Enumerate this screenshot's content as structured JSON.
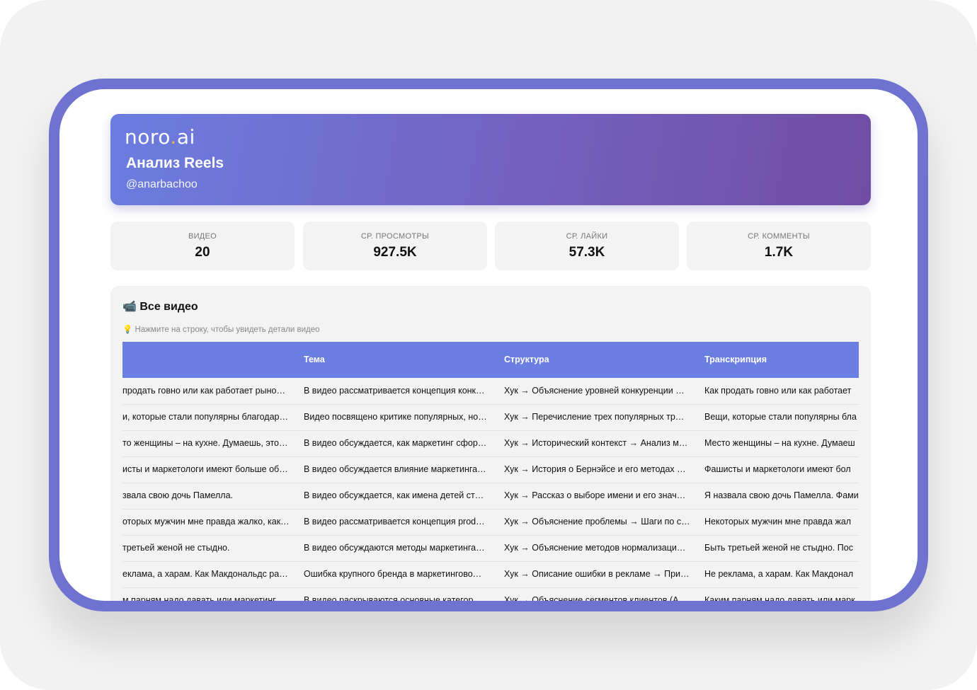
{
  "header": {
    "logo_left": "noro",
    "logo_dot": ".",
    "logo_right": "ai",
    "title": "Анализ Reels",
    "account": "@anarbachoo"
  },
  "stats": [
    {
      "label": "ВИДЕО",
      "value": "20"
    },
    {
      "label": "СР. ПРОСМОТРЫ",
      "value": "927.5K"
    },
    {
      "label": "СР. ЛАЙКИ",
      "value": "57.3K"
    },
    {
      "label": "СР. КОММЕНТЫ",
      "value": "1.7K"
    }
  ],
  "videos": {
    "title": "📹 Все видео",
    "hint": "💡 Нажмите на строку, чтобы увидеть детали видео",
    "columns": [
      "",
      "Тема",
      "Структура",
      "Транскрипция"
    ],
    "rows": [
      [
        "продать говно или как работает рыно…",
        "В видео рассматривается концепция конк…",
        "Хук → Объяснение уровней конкуренции …",
        "Как продать говно или как работает"
      ],
      [
        "и, которые стали популярны благодар…",
        "Видео посвящено критике популярных, но…",
        "Хук → Перечисление трех популярных тр…",
        "Вещи, которые стали популярны бла"
      ],
      [
        "то женщины – на кухне. Думаешь, это…",
        "В видео обсуждается, как маркетинг сфор…",
        "Хук → Исторический контекст → Анализ м…",
        "Место женщины – на кухне. Думаеш"
      ],
      [
        "исты и маркетологи имеют больше об…",
        "В видео обсуждается влияние маркетинга…",
        "Хук → История о Бернэйсе и его методах …",
        "Фашисты и маркетологи имеют бол"
      ],
      [
        "звала свою дочь Памелла.",
        "В видео обсуждается, как имена детей ст…",
        "Хук → Рассказ о выборе имени и его знач…",
        "Я назвала свою дочь Памелла. Фами"
      ],
      [
        "оторых мужчин мне правда жалко, как…",
        "В видео рассматривается концепция prod…",
        "Хук → Объяснение проблемы → Шаги по с…",
        "Некоторых мужчин мне правда жал"
      ],
      [
        "третьей женой не стыдно.",
        "В видео обсуждаются методы маркетинга…",
        "Хук → Объяснение методов нормализаци…",
        "Быть третьей женой не стыдно. Пос"
      ],
      [
        "еклама, а харам. Как Макдональдс ра…",
        "Ошибка крупного бренда в маркетингово…",
        "Хук → Описание ошибки в рекламе → При…",
        "Не реклама, а харам. Как Макдонал"
      ],
      [
        "м парням надо давать или маркетинг…",
        "В видео раскрываются основные категор…",
        "Хук → Объяснение сегментов клиентов (А…",
        "Каким парням надо давать или марк"
      ]
    ]
  }
}
